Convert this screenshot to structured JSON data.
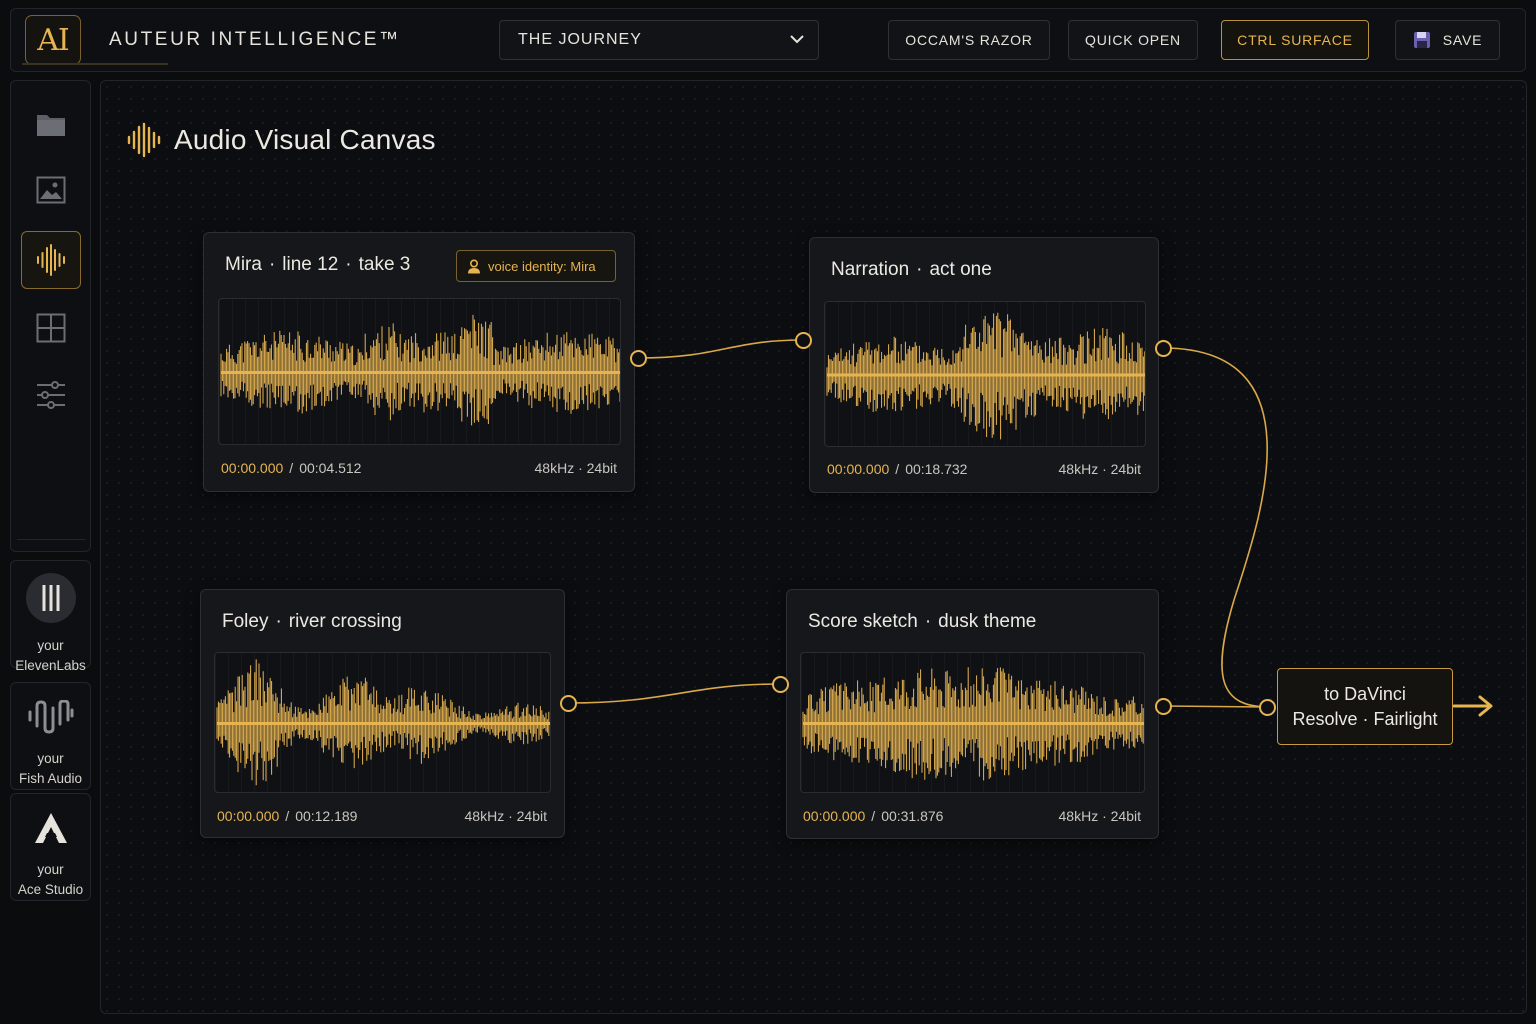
{
  "header": {
    "logo_text": "AI",
    "app_title": "AUTEUR INTELLIGENCE™",
    "project": "THE JOURNEY",
    "buttons": {
      "occams_razor": "OCCAM'S RAZOR",
      "quick_open": "QUICK OPEN",
      "ctrl_surface": "CTRL SURFACE",
      "save": "SAVE"
    }
  },
  "sidebar": {
    "icons": [
      "folder-icon",
      "image-icon",
      "waveform-icon",
      "grid-icon",
      "sliders-icon"
    ],
    "active": "waveform-icon"
  },
  "providers": [
    {
      "line1": "your",
      "line2": "ElevenLabs",
      "icon": "elevenlabs-icon"
    },
    {
      "line1": "your",
      "line2": "Fish Audio",
      "icon": "fish-audio-icon"
    },
    {
      "line1": "your",
      "line2": "Ace Studio",
      "icon": "ace-studio-icon"
    }
  ],
  "canvas": {
    "title": "Audio Visual Canvas",
    "nodes": {
      "mira": {
        "title": [
          "Mira",
          "line 12",
          "take 3"
        ],
        "badge": "voice identity: Mira",
        "current": "00:00.000",
        "duration": "00:04.512",
        "format": "48kHz · 24bit"
      },
      "narration": {
        "title": [
          "Narration",
          "act one"
        ],
        "current": "00:00.000",
        "duration": "00:18.732",
        "format": "48kHz · 24bit"
      },
      "foley": {
        "title": [
          "Foley",
          "river crossing"
        ],
        "current": "00:00.000",
        "duration": "00:12.189",
        "format": "48kHz · 24bit"
      },
      "score": {
        "title": [
          "Score sketch",
          "dusk theme"
        ],
        "current": "00:00.000",
        "duration": "00:31.876",
        "format": "48kHz · 24bit"
      }
    },
    "export": {
      "line1": "to DaVinci",
      "line2": "Resolve · Fairlight"
    },
    "dot": "·",
    "slash": "/"
  },
  "colors": {
    "accent": "#e6b451",
    "background": "#0b0c0e",
    "panel": "#15171b"
  }
}
